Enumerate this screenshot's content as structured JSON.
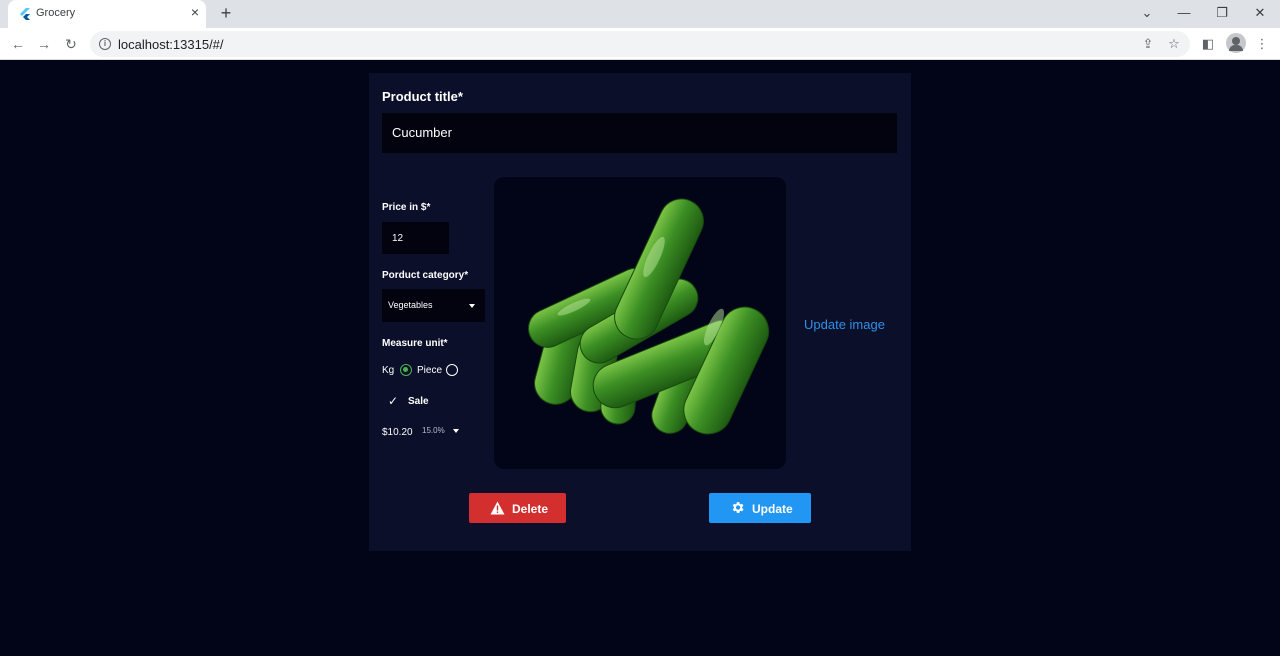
{
  "browser": {
    "tab_title": "Grocery",
    "tab_close": "×",
    "new_tab": "+",
    "url": "localhost:13315/#/"
  },
  "form": {
    "title_label": "Product title*",
    "title_value": "Cucumber",
    "price_label": "Price in $*",
    "price_value": "12",
    "category_label": "Porduct category*",
    "category_value": "Vegetables",
    "measure_label": "Measure unit*",
    "measure_options": [
      {
        "label": "Kg",
        "selected": true
      },
      {
        "label": "Piece",
        "selected": false
      }
    ],
    "sale_label": "Sale",
    "sale_checked": true,
    "sale_price": "$10.20",
    "sale_percent": "15.0%",
    "image_subject": "cucumbers",
    "update_image_label": "Update image",
    "delete_label": "Delete",
    "update_label": "Update"
  },
  "colors": {
    "background": "#020418",
    "card": "#0b0f29",
    "input": "#02030f",
    "link": "#2f8fe8",
    "delete": "#d32f2f",
    "update": "#2196f3",
    "radio_selected": "#4caf50"
  }
}
